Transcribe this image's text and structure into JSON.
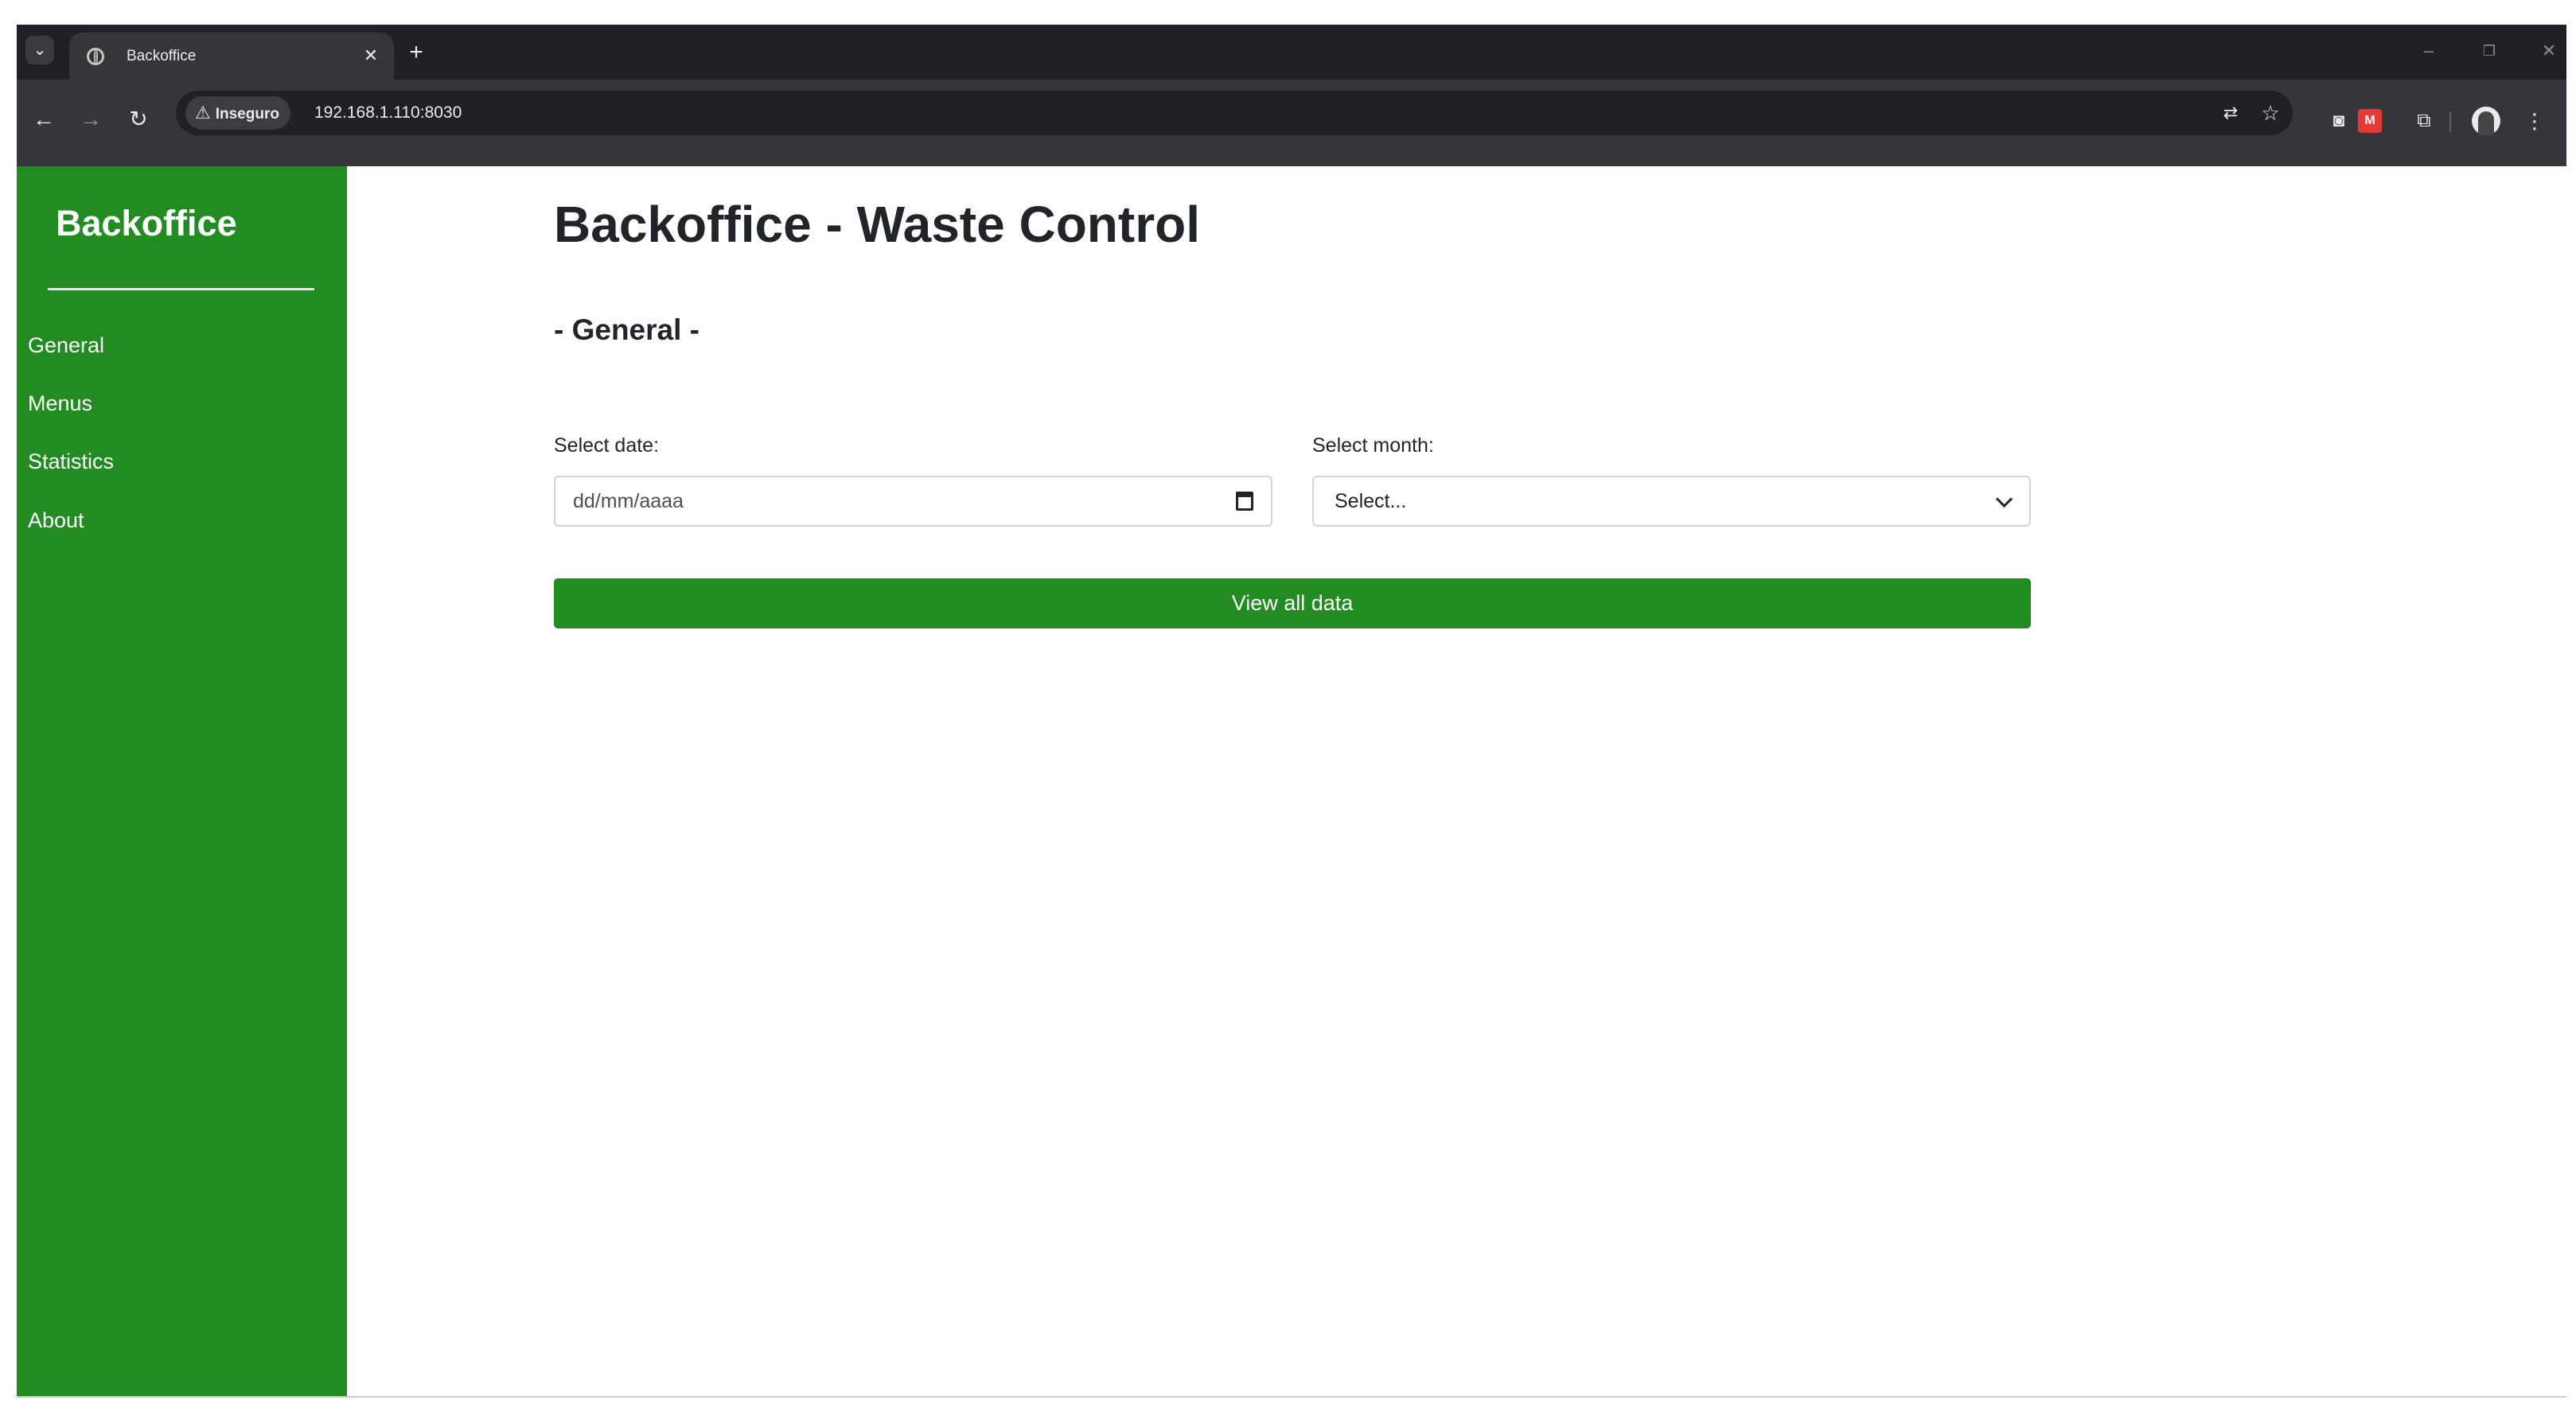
{
  "browser": {
    "tab": {
      "title": "Backoffice",
      "close_glyph": "✕",
      "favicon": "globe-icon"
    },
    "tab_search_glyph": "⌄",
    "new_tab_glyph": "+",
    "window_controls": {
      "minimize": "–",
      "restore": "❐",
      "close": "✕"
    },
    "toolbar": {
      "back_glyph": "←",
      "forward_glyph": "→",
      "reload_glyph": "↻",
      "menu_glyph": "⋮"
    },
    "address_bar": {
      "security_label": "Inseguro",
      "security_glyph": "⚠",
      "url": "192.168.1.110:8030",
      "translate_glyph": "⇄",
      "bookmark_glyph": "☆"
    },
    "extensions": {
      "camera_glyph": "◙",
      "red_ext_glyph": "M",
      "puzzle_glyph": "⧉"
    }
  },
  "sidebar": {
    "brand": "Backoffice",
    "items": [
      {
        "label": "General"
      },
      {
        "label": "Menus"
      },
      {
        "label": "Statistics"
      },
      {
        "label": "About"
      }
    ]
  },
  "main": {
    "title": "Backoffice - Waste Control",
    "section_title": "- General -",
    "date_field": {
      "label": "Select date:",
      "placeholder": "dd/mm/aaaa"
    },
    "month_field": {
      "label": "Select month:",
      "selected": "Select..."
    },
    "view_all_button": "View all data"
  },
  "colors": {
    "sidebar_green": "#228b22",
    "button_green": "#228b22",
    "browser_frame": "#202124",
    "browser_toolbar": "#35363a"
  }
}
